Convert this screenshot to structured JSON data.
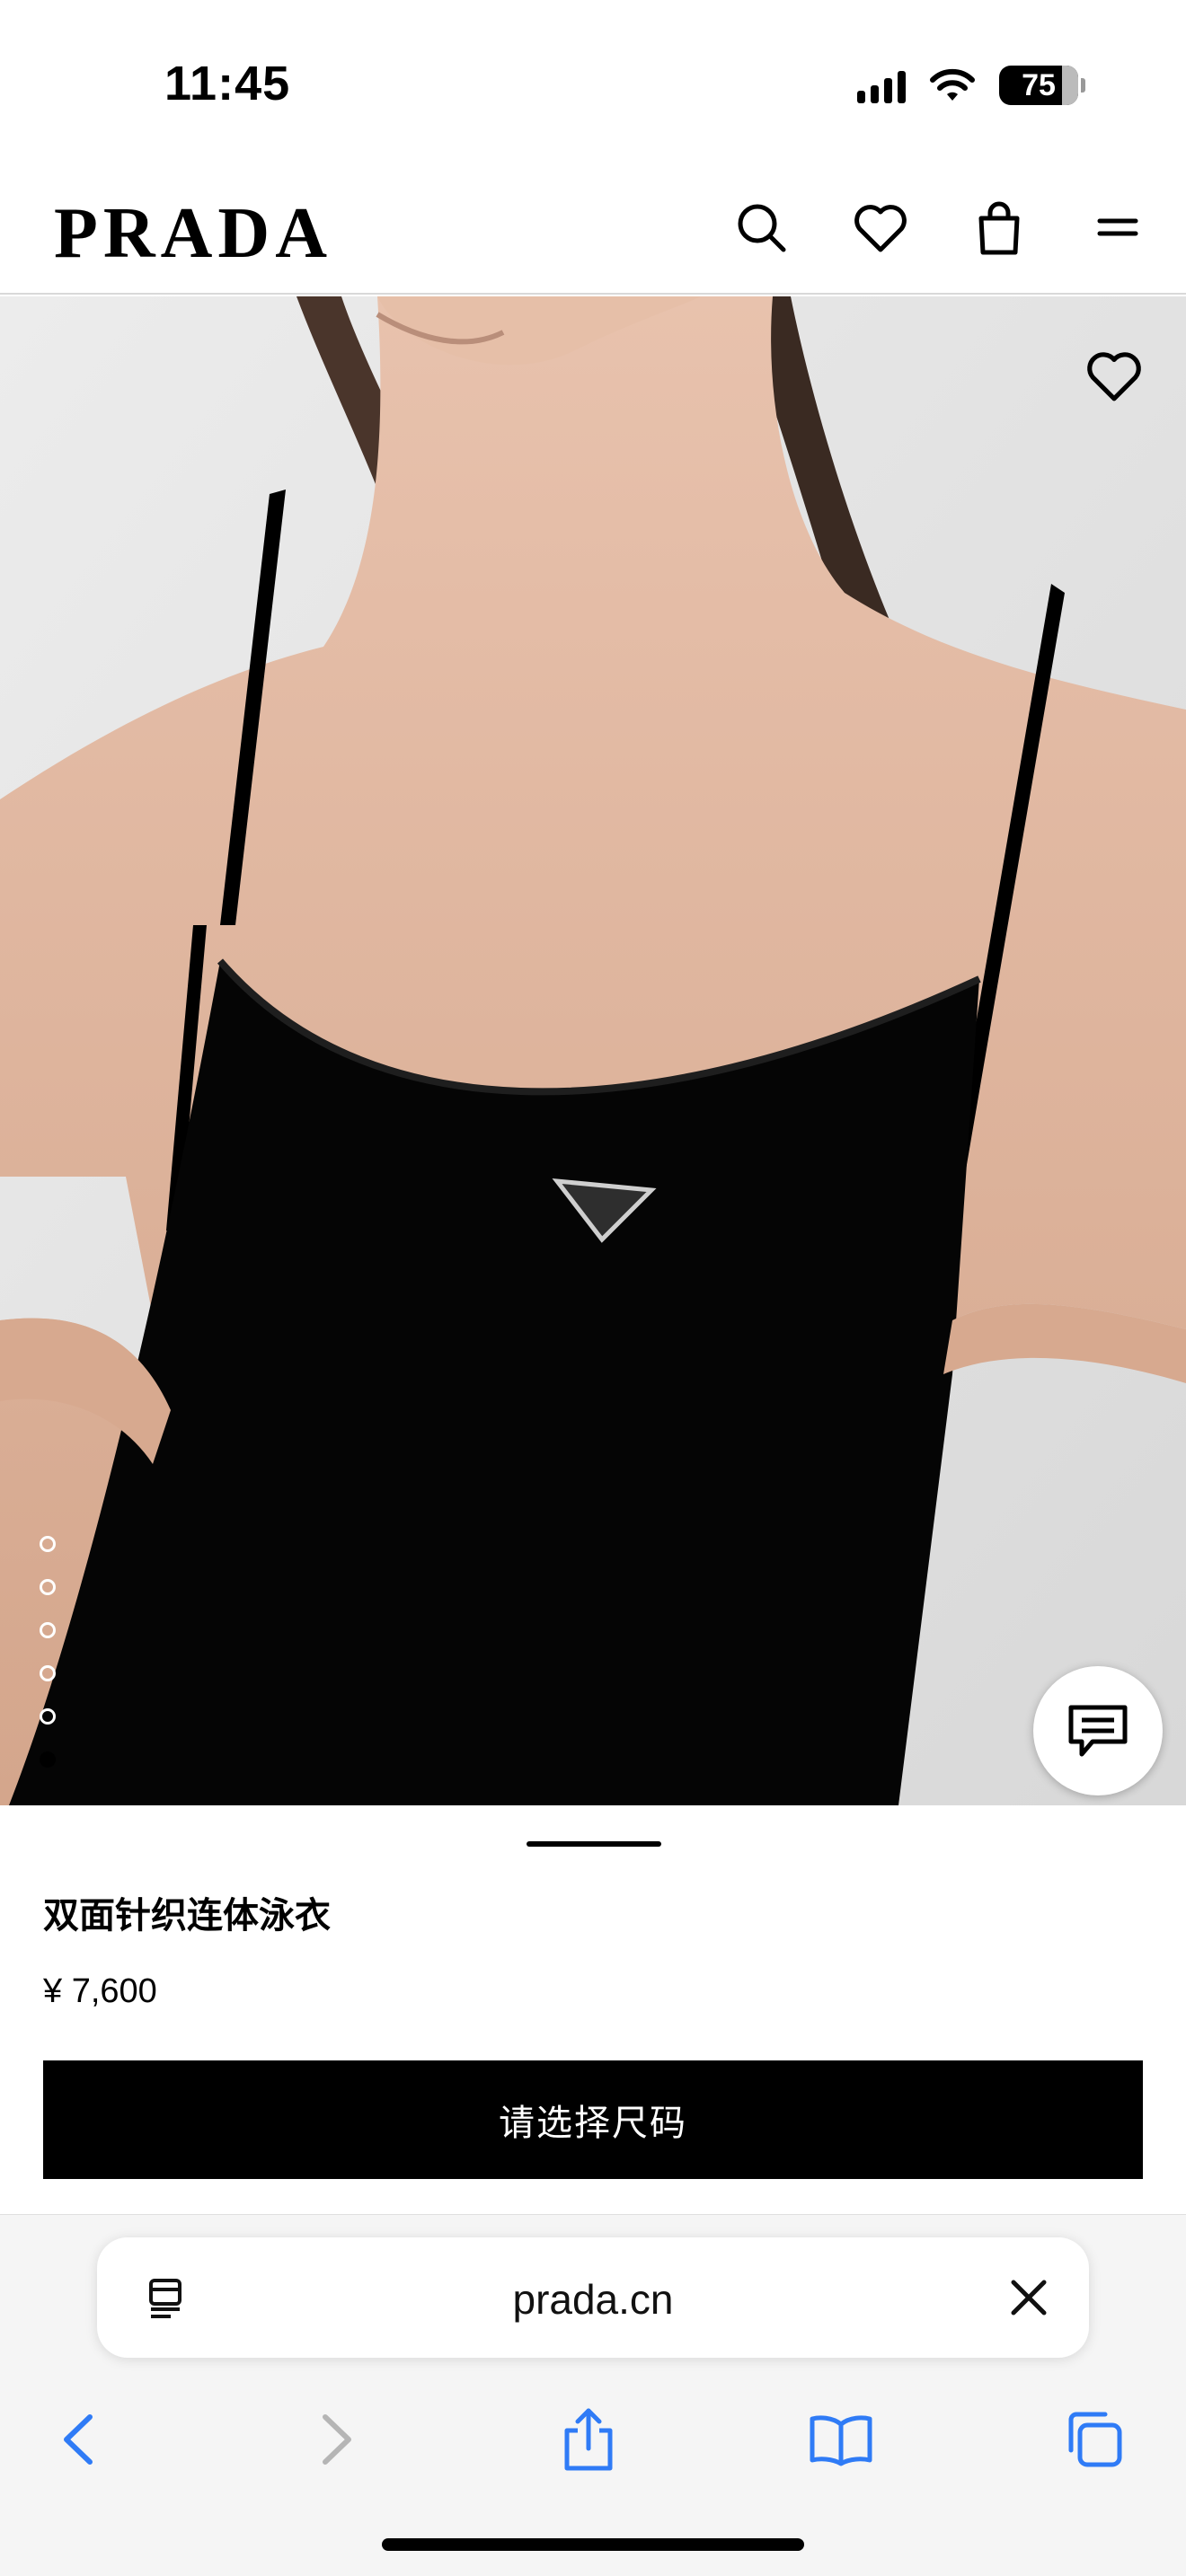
{
  "status_bar": {
    "time": "11:45",
    "battery": "75"
  },
  "header": {
    "logo": "PRADA",
    "icons": [
      "search-icon",
      "heart-icon",
      "shopping-bag-icon",
      "menu-icon"
    ]
  },
  "hero": {
    "favorite_icon": "heart-icon",
    "gallery_dots_count": 6,
    "active_dot_index": 5,
    "chat_icon": "chat-icon"
  },
  "product": {
    "title": "双面针织连体泳衣",
    "price": "¥ 7,600",
    "cta": "请选择尺码"
  },
  "browser": {
    "url": "prada.cn",
    "toolbar": [
      "back-icon",
      "forward-icon",
      "share-icon",
      "bookmarks-icon",
      "tabs-icon"
    ]
  }
}
